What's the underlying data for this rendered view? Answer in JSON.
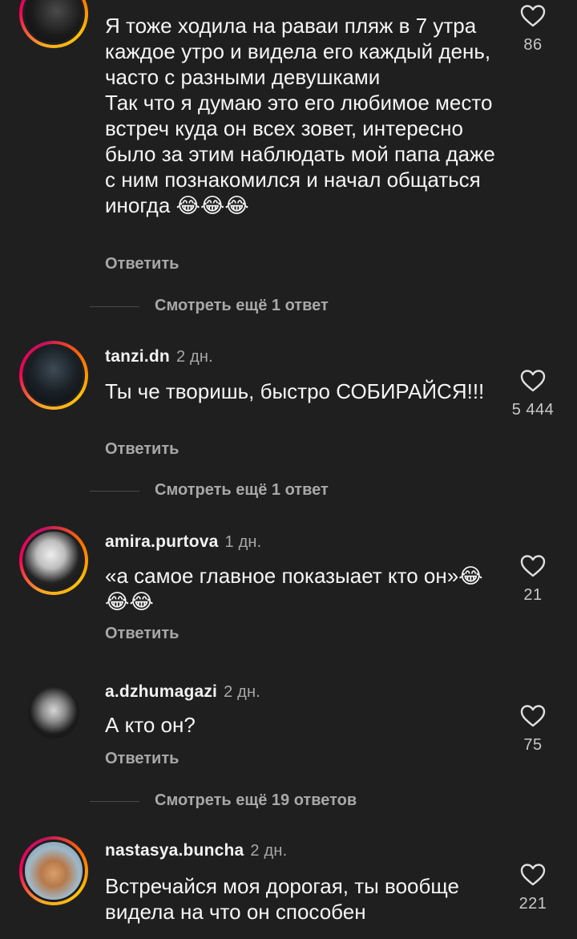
{
  "comments": [
    {
      "username": "",
      "time": "",
      "text": "Я тоже ходила на раваи пляж в 7 утра каждое утро и видела его каждый день, часто с разными девушками\nТак что я думаю это его любимое место встреч куда он всех зовет, интересно было за этим наблюдать мой папа даже с ним познакомился и начал общаться иногда 😂😂😂",
      "reply_label": "Ответить",
      "likes": "86"
    },
    {
      "username": "tanzi.dn",
      "time": "2 дн.",
      "text": "Ты че творишь, быстро СОБИРАЙСЯ!!!",
      "reply_label": "Ответить",
      "likes": "5 444"
    },
    {
      "username": "amira.purtova",
      "time": "1 дн.",
      "text": "«а самое главное показыает кто он»😂😂😂",
      "reply_label": "Ответить",
      "likes": "21"
    },
    {
      "username": "a.dzhumagazi",
      "time": "2 дн.",
      "text": "А кто он?",
      "reply_label": "Ответить",
      "likes": "75"
    },
    {
      "username": "nastasya.buncha",
      "time": "2 дн.",
      "text": "Встречайся моя дорогая, ты вообще видела на что он способен",
      "reply_label": "",
      "likes": "221"
    }
  ],
  "view_more": [
    "Смотреть ещё 1 ответ",
    "Смотреть ещё 1 ответ",
    "Смотреть ещё 19 ответов"
  ],
  "icons": {
    "like": "heart-outline-icon"
  },
  "colors": {
    "background": "#1f1f1f",
    "text": "#f5f5f5",
    "secondary": "#a8a8a8",
    "story_ring": "#f50057"
  }
}
